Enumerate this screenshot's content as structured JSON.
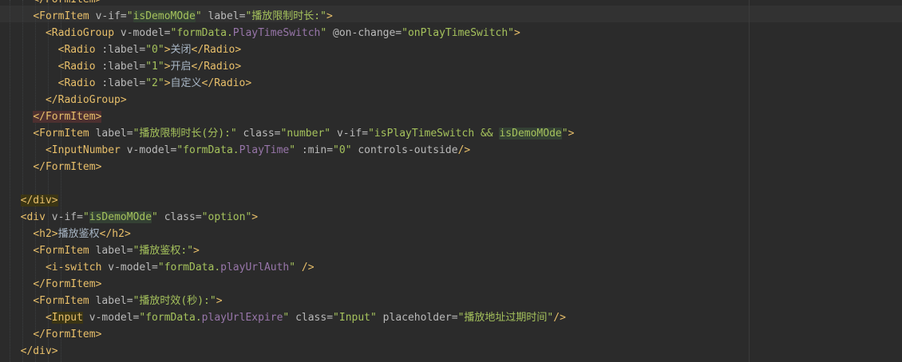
{
  "editor": {
    "lines": [
      [
        {
          "t": "    </FormItem>",
          "c": "tag"
        }
      ],
      [
        {
          "t": "    ",
          "c": "plain"
        },
        {
          "t": "<FormItem",
          "c": "tag"
        },
        {
          "t": " v-if=",
          "c": "attr"
        },
        {
          "t": "\"",
          "c": "str"
        },
        {
          "t": "isDemoMOde",
          "c": "str",
          "hl": "green"
        },
        {
          "t": "\"",
          "c": "str"
        },
        {
          "t": " label=",
          "c": "attr"
        },
        {
          "t": "\"播放限制时长:\"",
          "c": "str"
        },
        {
          "t": ">",
          "c": "tag"
        }
      ],
      [
        {
          "t": "      ",
          "c": "plain"
        },
        {
          "t": "<RadioGroup",
          "c": "tag"
        },
        {
          "t": " v-model=",
          "c": "attr"
        },
        {
          "t": "\"",
          "c": "str"
        },
        {
          "t": "formData.",
          "c": "str"
        },
        {
          "t": "PlayTimeSwitch",
          "c": "var"
        },
        {
          "t": "\"",
          "c": "str"
        },
        {
          "t": " @on-change=",
          "c": "attr"
        },
        {
          "t": "\"onPlayTimeSwitch\"",
          "c": "str"
        },
        {
          "t": ">",
          "c": "tag"
        }
      ],
      [
        {
          "t": "        ",
          "c": "plain"
        },
        {
          "t": "<Radio",
          "c": "tag"
        },
        {
          "t": " :label=",
          "c": "attr"
        },
        {
          "t": "\"0\"",
          "c": "str"
        },
        {
          "t": ">",
          "c": "tag"
        },
        {
          "t": "关闭",
          "c": "text"
        },
        {
          "t": "</Radio>",
          "c": "tag"
        }
      ],
      [
        {
          "t": "        ",
          "c": "plain"
        },
        {
          "t": "<Radio",
          "c": "tag"
        },
        {
          "t": " :label=",
          "c": "attr"
        },
        {
          "t": "\"1\"",
          "c": "str"
        },
        {
          "t": ">",
          "c": "tag"
        },
        {
          "t": "开启",
          "c": "text"
        },
        {
          "t": "</Radio>",
          "c": "tag"
        }
      ],
      [
        {
          "t": "        ",
          "c": "plain"
        },
        {
          "t": "<Radio",
          "c": "tag"
        },
        {
          "t": " :label=",
          "c": "attr"
        },
        {
          "t": "\"2\"",
          "c": "str"
        },
        {
          "t": ">",
          "c": "tag"
        },
        {
          "t": "自定义",
          "c": "text"
        },
        {
          "t": "</Radio>",
          "c": "tag"
        }
      ],
      [
        {
          "t": "      ",
          "c": "plain"
        },
        {
          "t": "</RadioGroup>",
          "c": "tag"
        }
      ],
      [
        {
          "t": "    ",
          "c": "plain"
        },
        {
          "t": "</FormItem>",
          "c": "tag",
          "hl": "red"
        }
      ],
      [
        {
          "t": "    ",
          "c": "plain"
        },
        {
          "t": "<FormItem",
          "c": "tag"
        },
        {
          "t": " label=",
          "c": "attr"
        },
        {
          "t": "\"播放限制时长(分):\"",
          "c": "str"
        },
        {
          "t": " class=",
          "c": "attr"
        },
        {
          "t": "\"number\"",
          "c": "str"
        },
        {
          "t": " v-if=",
          "c": "attr"
        },
        {
          "t": "\"isPlayTimeSwitch && ",
          "c": "str"
        },
        {
          "t": "isDemoMOde",
          "c": "str",
          "hl": "green"
        },
        {
          "t": "\"",
          "c": "str"
        },
        {
          "t": ">",
          "c": "tag"
        }
      ],
      [
        {
          "t": "      ",
          "c": "plain"
        },
        {
          "t": "<InputNumber",
          "c": "tag"
        },
        {
          "t": " v-model=",
          "c": "attr"
        },
        {
          "t": "\"",
          "c": "str"
        },
        {
          "t": "formData.",
          "c": "str"
        },
        {
          "t": "PlayTime",
          "c": "var"
        },
        {
          "t": "\"",
          "c": "str"
        },
        {
          "t": " :min=",
          "c": "attr"
        },
        {
          "t": "\"0\"",
          "c": "str"
        },
        {
          "t": " controls-outside",
          "c": "attr"
        },
        {
          "t": "/>",
          "c": "tag"
        }
      ],
      [
        {
          "t": "    ",
          "c": "plain"
        },
        {
          "t": "</FormItem>",
          "c": "tag"
        }
      ],
      [
        {
          "t": "",
          "c": "plain"
        }
      ],
      [
        {
          "t": "  ",
          "c": "plain"
        },
        {
          "t": "</div>",
          "c": "tag",
          "hl": "brace"
        }
      ],
      [
        {
          "t": "  ",
          "c": "plain"
        },
        {
          "t": "<div",
          "c": "tag"
        },
        {
          "t": " v-if=",
          "c": "attr"
        },
        {
          "t": "\"",
          "c": "str"
        },
        {
          "t": "isDemoMOde",
          "c": "str",
          "hl": "green"
        },
        {
          "t": "\"",
          "c": "str"
        },
        {
          "t": " class=",
          "c": "attr"
        },
        {
          "t": "\"option\"",
          "c": "str"
        },
        {
          "t": ">",
          "c": "tag"
        }
      ],
      [
        {
          "t": "    ",
          "c": "plain"
        },
        {
          "t": "<h2>",
          "c": "tag"
        },
        {
          "t": "播放鉴权",
          "c": "text"
        },
        {
          "t": "</h2>",
          "c": "tag"
        }
      ],
      [
        {
          "t": "    ",
          "c": "plain"
        },
        {
          "t": "<FormItem",
          "c": "tag"
        },
        {
          "t": " label=",
          "c": "attr"
        },
        {
          "t": "\"播放鉴权:\"",
          "c": "str"
        },
        {
          "t": ">",
          "c": "tag"
        }
      ],
      [
        {
          "t": "      ",
          "c": "plain"
        },
        {
          "t": "<i-switch",
          "c": "tag"
        },
        {
          "t": " v-model=",
          "c": "attr"
        },
        {
          "t": "\"",
          "c": "str"
        },
        {
          "t": "formData.",
          "c": "str"
        },
        {
          "t": "playUrlAuth",
          "c": "var"
        },
        {
          "t": "\"",
          "c": "str"
        },
        {
          "t": " />",
          "c": "tag"
        }
      ],
      [
        {
          "t": "    ",
          "c": "plain"
        },
        {
          "t": "</FormItem>",
          "c": "tag"
        }
      ],
      [
        {
          "t": "    ",
          "c": "plain"
        },
        {
          "t": "<FormItem",
          "c": "tag"
        },
        {
          "t": " label=",
          "c": "attr"
        },
        {
          "t": "\"播放时效(秒):\"",
          "c": "str"
        },
        {
          "t": ">",
          "c": "tag"
        }
      ],
      [
        {
          "t": "      ",
          "c": "plain"
        },
        {
          "t": "<",
          "c": "tag"
        },
        {
          "t": "Input",
          "c": "tag",
          "hl": "brace"
        },
        {
          "t": " v-model=",
          "c": "attr"
        },
        {
          "t": "\"",
          "c": "str"
        },
        {
          "t": "formData.",
          "c": "str"
        },
        {
          "t": "playUrlExpire",
          "c": "var"
        },
        {
          "t": "\"",
          "c": "str"
        },
        {
          "t": " class=",
          "c": "attr"
        },
        {
          "t": "\"Input\"",
          "c": "str"
        },
        {
          "t": " placeholder=",
          "c": "attr"
        },
        {
          "t": "\"播放地址过期时间\"",
          "c": "str"
        },
        {
          "t": "/>",
          "c": "tag"
        }
      ],
      [
        {
          "t": "    ",
          "c": "plain"
        },
        {
          "t": "</FormItem>",
          "c": "tag"
        }
      ],
      [
        {
          "t": "  ",
          "c": "plain"
        },
        {
          "t": "</div>",
          "c": "tag"
        }
      ]
    ]
  }
}
